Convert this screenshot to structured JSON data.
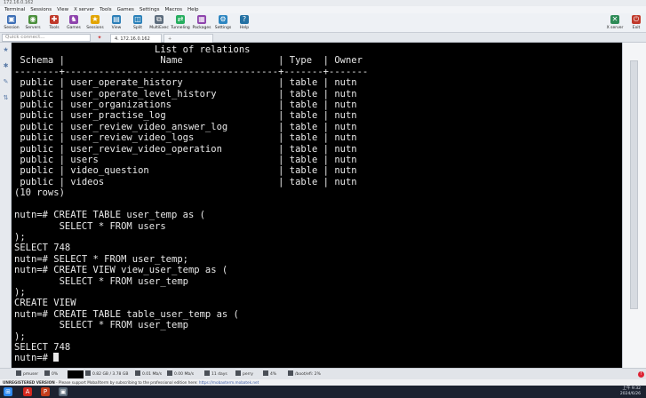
{
  "window": {
    "title": "172.16.0.162"
  },
  "menu": [
    "Terminal",
    "Sessions",
    "View",
    "X server",
    "Tools",
    "Games",
    "Settings",
    "Macros",
    "Help"
  ],
  "toolbar": {
    "items": [
      {
        "label": "Session",
        "icon": "session-icon",
        "color": "#3d6fb6"
      },
      {
        "label": "Servers",
        "icon": "servers-icon",
        "color": "#4b8f3c"
      },
      {
        "label": "Tools",
        "icon": "tools-icon",
        "color": "#c0392b"
      },
      {
        "label": "Games",
        "icon": "games-icon",
        "color": "#8e44ad"
      },
      {
        "label": "Sessions",
        "icon": "sessions-icon",
        "color": "#e2a400"
      },
      {
        "label": "View",
        "icon": "view-icon",
        "color": "#2c7fb8"
      },
      {
        "label": "Split",
        "icon": "split-icon",
        "color": "#2980b9"
      },
      {
        "label": "MultiExec",
        "icon": "multiexec-icon",
        "color": "#5d6d7e"
      },
      {
        "label": "Tunneling",
        "icon": "tunneling-icon",
        "color": "#27ae60"
      },
      {
        "label": "Packages",
        "icon": "packages-icon",
        "color": "#8e44ad"
      },
      {
        "label": "Settings",
        "icon": "settings-icon",
        "color": "#2e86c1"
      },
      {
        "label": "Help",
        "icon": "help-icon",
        "color": "#2471a3"
      }
    ],
    "right_items": [
      {
        "label": "X server",
        "icon": "x-server-icon",
        "color": "#2e8b57"
      },
      {
        "label": "Exit",
        "icon": "exit-icon",
        "color": "#c0392b"
      }
    ]
  },
  "session_bar": {
    "quick_connect_placeholder": "Quick connect...",
    "active_tab": "4. 172.16.0.162",
    "new_tab": "+"
  },
  "terminal": {
    "lines": [
      "                         List of relations",
      " Schema |                 Name                 | Type  | Owner",
      "--------+--------------------------------------+-------+-------",
      " public | user_operate_history                 | table | nutn",
      " public | user_operate_level_history           | table | nutn",
      " public | user_organizations                   | table | nutn",
      " public | user_practise_log                    | table | nutn",
      " public | user_review_video_answer_log         | table | nutn",
      " public | user_review_video_logs               | table | nutn",
      " public | user_review_video_operation          | table | nutn",
      " public | users                                | table | nutn",
      " public | video_question                       | table | nutn",
      " public | videos                               | table | nutn",
      "(10 rows)",
      "",
      "nutn=# CREATE TABLE user_temp as (",
      "        SELECT * FROM users",
      ");",
      "SELECT 748",
      "nutn=# SELECT * FROM user_temp;",
      "nutn=# CREATE VIEW view_user_temp as (",
      "        SELECT * FROM user_temp",
      ");",
      "CREATE VIEW",
      "nutn=# CREATE TABLE table_user_temp as (",
      "        SELECT * FROM user_temp",
      ");",
      "SELECT 748"
    ],
    "prompt": "nutn=# "
  },
  "status_bar": {
    "items": [
      "pmuser",
      "0%",
      "0.82 GB / 3.78 GB",
      "0.01 Mb/s",
      "0.00 Mb/s",
      "11 days",
      "perry",
      "4%",
      "/boot/efi: 2%"
    ]
  },
  "info_bar": {
    "unregistered": "UNREGISTERED VERSION",
    "message": " - Please support MobaXterm by subscribing to the professional edition here: ",
    "link": "https://mobaxterm.mobatek.net"
  },
  "taskbar": {
    "icons": [
      {
        "icon": "windows-start-icon",
        "color": "#2d89ef"
      },
      {
        "icon": "acrobat-icon",
        "color": "#d4281e"
      },
      {
        "icon": "powerpoint-icon",
        "color": "#c43e1c"
      },
      {
        "icon": "mobaxterm-icon",
        "color": "#5b6b7a"
      }
    ],
    "time": "上午 9:32",
    "date": "2024/6/26"
  }
}
